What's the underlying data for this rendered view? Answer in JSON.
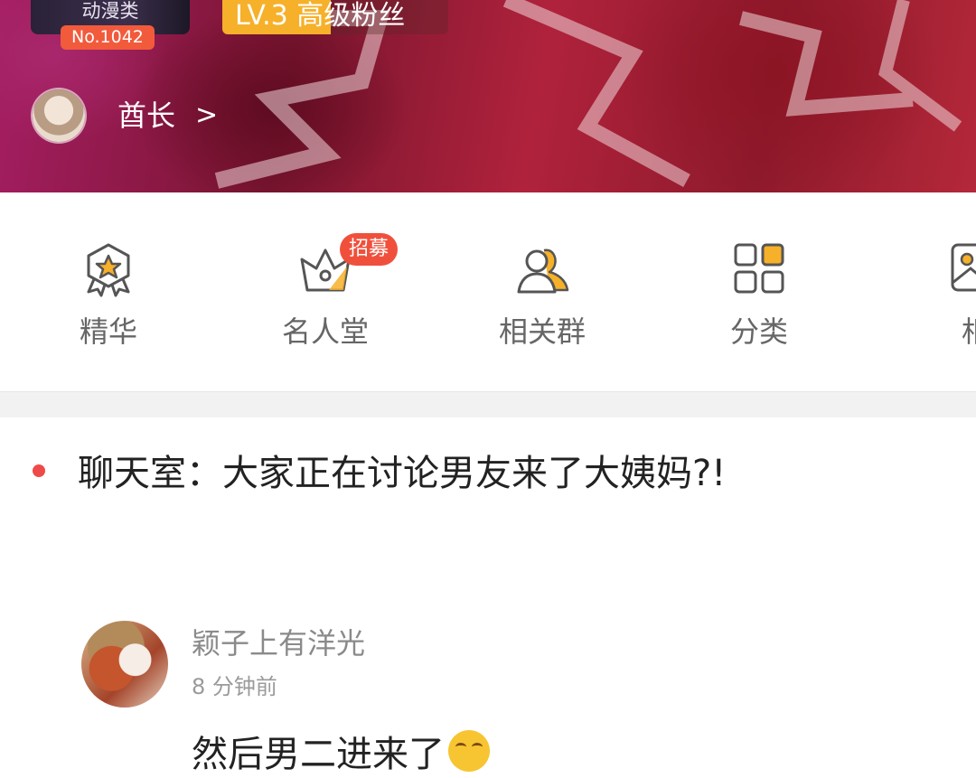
{
  "banner": {
    "category": "动漫类",
    "rank_badge": "No.1042",
    "level_badge": "LV.3 高级粉丝",
    "level_progress": 0.48,
    "owner_label": "酋长",
    "owner_chevron": ">"
  },
  "nav": {
    "items": [
      {
        "label": "精华",
        "icon": "star-ribbon-icon"
      },
      {
        "label": "名人堂",
        "icon": "crown-icon",
        "badge": "招募"
      },
      {
        "label": "相关群",
        "icon": "people-icon"
      },
      {
        "label": "分类",
        "icon": "grid-icon"
      },
      {
        "label": "相",
        "icon": "image-icon"
      }
    ]
  },
  "chat": {
    "title": "聊天室：大家正在讨论男友来了大姨妈?!"
  },
  "post": {
    "author": "颖子上有洋光",
    "time": "8 分钟前",
    "content": "然后男二进来了",
    "emoji": "tears-of-joy-emoji"
  },
  "colors": {
    "accent": "#f6b02a",
    "badge_red": "#f0503b",
    "dot_red": "#ee4a4a"
  }
}
